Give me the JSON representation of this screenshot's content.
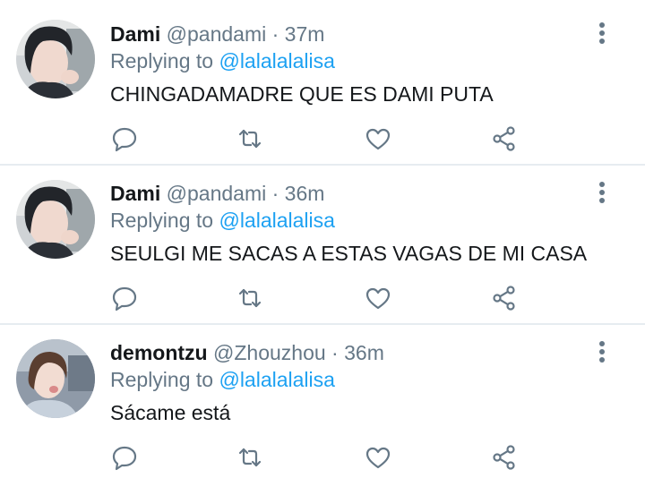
{
  "colors": {
    "text_primary": "#14171a",
    "text_secondary": "#657786",
    "link": "#1da1f2",
    "divider": "#e6ecf0",
    "icon": "#657786"
  },
  "tweets": [
    {
      "display_name": "Dami",
      "handle": "@pandami",
      "separator": "·",
      "time": "37m",
      "replying_prefix": "Replying to",
      "replying_to": "@lalalalalisa",
      "text": "CHINGADAMADRE QUE ES DAMI PUTA",
      "avatar_icon": "profile-photo-avatar",
      "actions": [
        "reply-icon",
        "retweet-icon",
        "like-icon",
        "share-icon"
      ],
      "menu_icon": "more-vertical-icon"
    },
    {
      "display_name": "Dami",
      "handle": "@pandami",
      "separator": "·",
      "time": "36m",
      "replying_prefix": "Replying to",
      "replying_to": "@lalalalalisa",
      "text": "SEULGI ME SACAS A ESTAS VAGAS DE MI CASA",
      "avatar_icon": "profile-photo-avatar",
      "actions": [
        "reply-icon",
        "retweet-icon",
        "like-icon",
        "share-icon"
      ],
      "menu_icon": "more-vertical-icon"
    },
    {
      "display_name": "demontzu",
      "handle": "@Zhouzhou",
      "separator": "·",
      "time": "36m",
      "replying_prefix": "Replying to",
      "replying_to": "@lalalalalisa",
      "text": "Sácame está",
      "avatar_icon": "profile-photo-avatar",
      "actions": [
        "reply-icon",
        "retweet-icon",
        "like-icon",
        "share-icon"
      ],
      "menu_icon": "more-vertical-icon"
    }
  ]
}
